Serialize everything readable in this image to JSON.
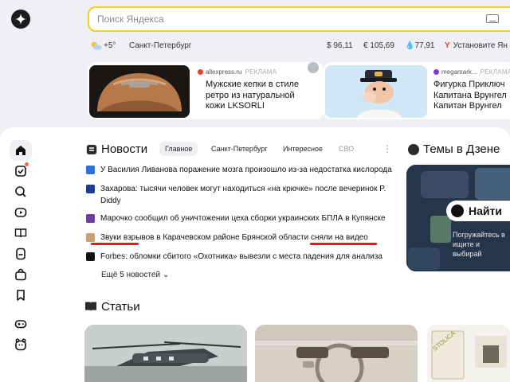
{
  "search": {
    "placeholder": "Поиск Яндекса"
  },
  "infobar": {
    "temperature": "+5°",
    "city": "Санкт-Петербург",
    "usd": "$ 96,11",
    "eur": "€ 105,69",
    "oil": "77,91",
    "install": "Установите Ян"
  },
  "ads": [
    {
      "source": "allexpress.ru",
      "tag": "РЕКЛАМА",
      "text": "Мужские кепки в стиле\nретро из натуральной\nкожи LKSORLI",
      "dot_color": "#e8402f"
    },
    {
      "source": "megamark...",
      "tag": "РЕКЛАМА",
      "text": "Фигурка Приключ\nКапитана Врунгел\nКапитан Врунгел",
      "dot_color": "#7a3fd0"
    }
  ],
  "news": {
    "title": "Новости",
    "tabs": [
      {
        "label": "Главное",
        "active": true
      },
      {
        "label": "Санкт-Петербург",
        "active": false
      },
      {
        "label": "Интересное",
        "active": false
      },
      {
        "label": "СВО",
        "active": false,
        "muted": true
      }
    ],
    "items": [
      {
        "text": "У Василия Ливанова поражение мозга произошло из-за недостатка кислорода",
        "src_color": "#2f6fd6"
      },
      {
        "text": "Захарова: тысячи человек могут находиться «на крючке» после вечеринок P. Diddy",
        "src_color": "#1d3b8f"
      },
      {
        "text": "Марочко сообщил об уничтожении цеха сборки украинских БПЛА в Купянске",
        "src_color": "#6b3fa0"
      },
      {
        "text": "Звуки взрывов в Карачевском районе Брянской области сняли на видео",
        "src_color": "#c9a074"
      },
      {
        "text": "Forbes: обломки сбитого «Охотника» вывезли с места падения для анализа",
        "src_color": "#111111"
      }
    ],
    "more": "Ещё 5 новостей"
  },
  "dzen": {
    "title": "Темы в Дзене",
    "find": "Найти",
    "text": "Погружайтесь в\nищите и выбирай"
  },
  "articles": {
    "title": "Статьи"
  },
  "sidebar": {
    "items": [
      "home",
      "tasks",
      "search",
      "video",
      "reading",
      "disk",
      "market",
      "bookmarks",
      "games",
      "kids"
    ]
  }
}
